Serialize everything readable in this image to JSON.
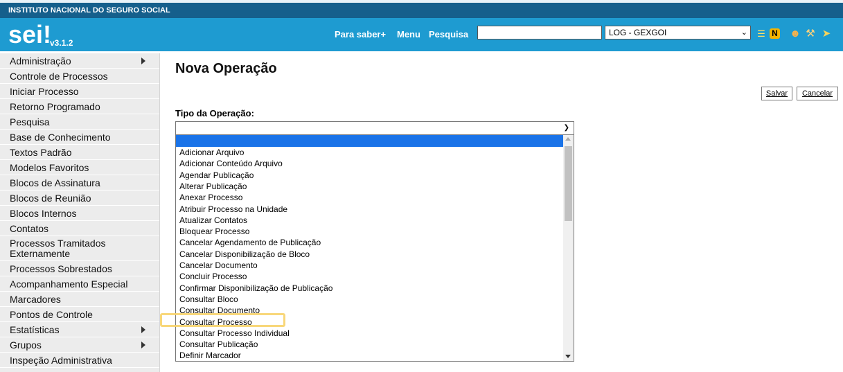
{
  "institution": "INSTITUTO NACIONAL DO SEGURO SOCIAL",
  "header": {
    "logo": "sei!",
    "version": "v3.1.2",
    "links": [
      "Para saber+",
      "Menu",
      "Pesquisa"
    ],
    "search_value": "",
    "unit": "LOG - GEXGOI",
    "icons": [
      "list-icon",
      "notes-icon",
      "user-icon",
      "wrench-icon",
      "exit-icon"
    ]
  },
  "sidebar": {
    "items": [
      {
        "label": "Administração",
        "submenu": true
      },
      {
        "label": "Controle de Processos",
        "submenu": false
      },
      {
        "label": "Iniciar Processo",
        "submenu": false
      },
      {
        "label": "Retorno Programado",
        "submenu": false
      },
      {
        "label": "Pesquisa",
        "submenu": false
      },
      {
        "label": "Base de Conhecimento",
        "submenu": false
      },
      {
        "label": "Textos Padrão",
        "submenu": false
      },
      {
        "label": "Modelos Favoritos",
        "submenu": false
      },
      {
        "label": "Blocos de Assinatura",
        "submenu": false
      },
      {
        "label": "Blocos de Reunião",
        "submenu": false
      },
      {
        "label": "Blocos Internos",
        "submenu": false
      },
      {
        "label": "Contatos",
        "submenu": false
      },
      {
        "label": "Processos Tramitados Externamente",
        "submenu": false
      },
      {
        "label": "Processos Sobrestados",
        "submenu": false
      },
      {
        "label": "Acompanhamento Especial",
        "submenu": false
      },
      {
        "label": "Marcadores",
        "submenu": false
      },
      {
        "label": "Pontos de Controle",
        "submenu": false
      },
      {
        "label": "Estatísticas",
        "submenu": true
      },
      {
        "label": "Grupos",
        "submenu": true
      },
      {
        "label": "Inspeção Administrativa",
        "submenu": false
      }
    ]
  },
  "main": {
    "title": "Nova Operação",
    "save_label": "Salvar",
    "cancel_label": "Cancelar",
    "operation_label": "Tipo da Operação:",
    "operation_value": "",
    "options": [
      "",
      "Adicionar Arquivo",
      "Adicionar Conteúdo Arquivo",
      "Agendar Publicação",
      "Alterar Publicação",
      "Anexar Processo",
      "Atribuir Processo na Unidade",
      "Atualizar Contatos",
      "Bloquear Processo",
      "Cancelar Agendamento de Publicação",
      "Cancelar Disponibilização de Bloco",
      "Cancelar Documento",
      "Concluir Processo",
      "Confirmar Disponibilização de Publicação",
      "Consultar Bloco",
      "Consultar Documento",
      "Consultar Processo",
      "Consultar Processo Individual",
      "Consultar Publicação",
      "Definir Marcador"
    ],
    "highlighted_option": "Consultar Processo"
  },
  "colors": {
    "institution_bar": "#155f8c",
    "header": "#1e9bd1",
    "selected_option": "#1a73e8",
    "highlight": "#f7d36c"
  }
}
